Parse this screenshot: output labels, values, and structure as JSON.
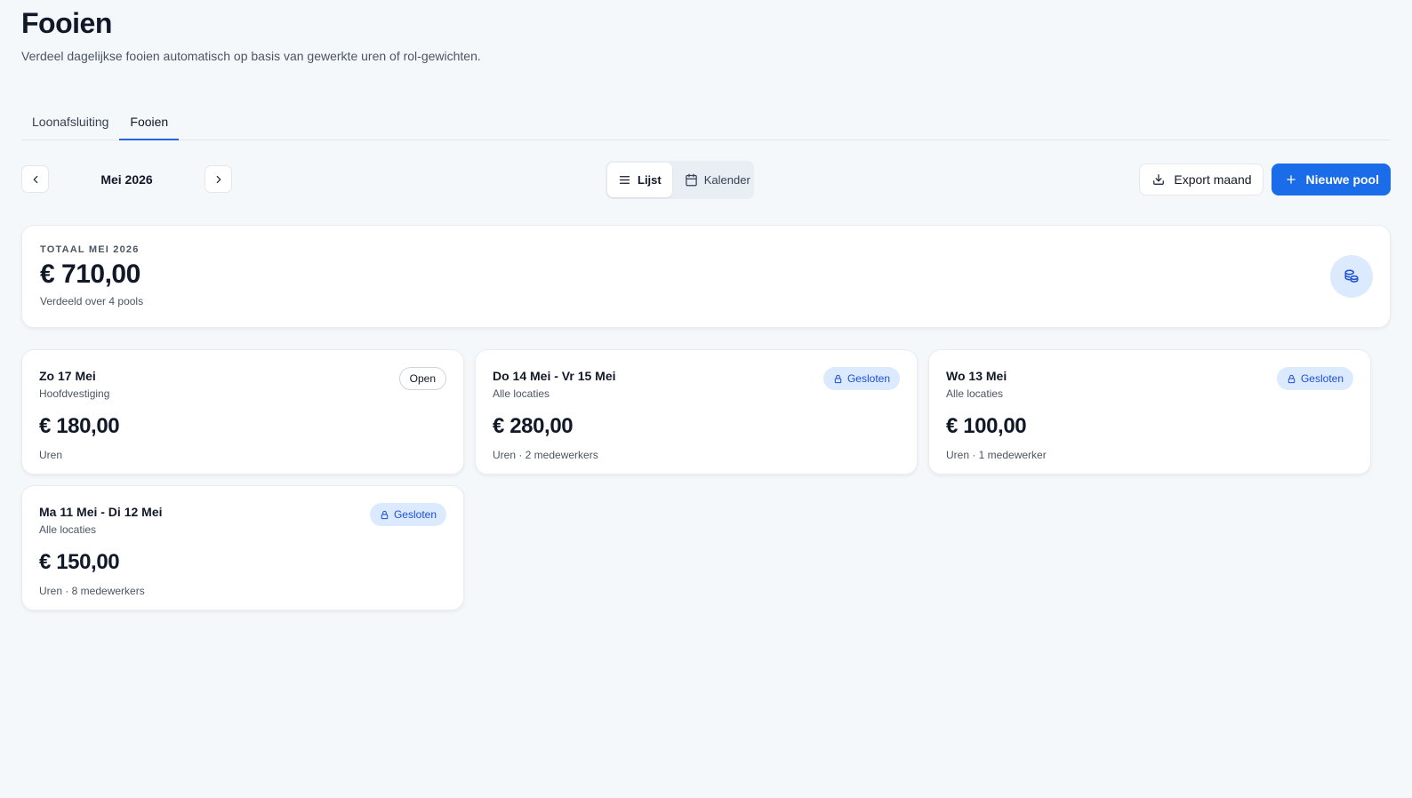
{
  "header": {
    "title": "Fooien",
    "subtitle": "Verdeel dagelijkse fooien automatisch op basis van gewerkte uren of rol-gewichten."
  },
  "tabs": [
    {
      "label": "Loonafsluiting",
      "active": false
    },
    {
      "label": "Fooien",
      "active": true
    }
  ],
  "toolbar": {
    "month": "Mei 2026",
    "views": [
      {
        "label": "Lijst",
        "icon": "list-icon",
        "active": true
      },
      {
        "label": "Kalender",
        "icon": "calendar-icon",
        "active": false
      }
    ],
    "export_label": "Export maand",
    "new_pool_label": "Nieuwe pool"
  },
  "summary": {
    "label": "TOTAAL MEI 2026",
    "amount": "€ 710,00",
    "sub": "Verdeeld over 4 pools",
    "icon": "coins-icon"
  },
  "pools": [
    {
      "title": "Zo 17 Mei",
      "location": "Hoofdvestiging",
      "amount": "€ 180,00",
      "meta": "Uren",
      "status": "Open",
      "locked": false
    },
    {
      "title": "Do 14 Mei - Vr 15 Mei",
      "location": "Alle locaties",
      "amount": "€ 280,00",
      "meta": "Uren · 2 medewerkers",
      "status": "Gesloten",
      "locked": true
    },
    {
      "title": "Wo 13 Mei",
      "location": "Alle locaties",
      "amount": "€ 100,00",
      "meta": "Uren · 1 medewerker",
      "status": "Gesloten",
      "locked": true
    },
    {
      "title": "Ma 11 Mei - Di 12 Mei",
      "location": "Alle locaties",
      "amount": "€ 150,00",
      "meta": "Uren · 8 medewerkers",
      "status": "Gesloten",
      "locked": true
    }
  ],
  "colors": {
    "primary": "#1a6ce8",
    "badge_closed_bg": "#dbeafe",
    "badge_closed_text": "#1d4ed8",
    "background": "#f5f8fb"
  }
}
